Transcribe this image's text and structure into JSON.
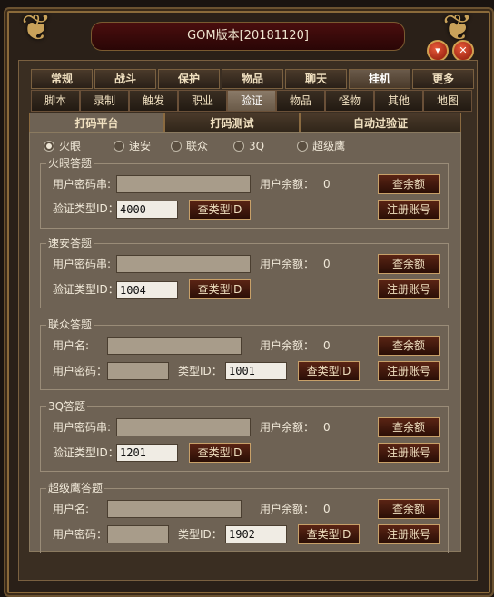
{
  "window": {
    "title": "GOM版本[20181120]"
  },
  "icons": {
    "minimize": "chevron-down-icon",
    "close": "close-icon",
    "corners": "dragon-ornament-icon"
  },
  "tabs_main": [
    {
      "label": "常规"
    },
    {
      "label": "战斗"
    },
    {
      "label": "保护"
    },
    {
      "label": "物品"
    },
    {
      "label": "聊天"
    },
    {
      "label": "挂机"
    },
    {
      "label": "更多"
    }
  ],
  "tabs_sub": [
    {
      "label": "脚本"
    },
    {
      "label": "录制"
    },
    {
      "label": "触发"
    },
    {
      "label": "职业"
    },
    {
      "label": "验证"
    },
    {
      "label": "物品"
    },
    {
      "label": "怪物"
    },
    {
      "label": "其他"
    },
    {
      "label": "地图"
    }
  ],
  "tabs_verify": [
    {
      "label": "打码平台"
    },
    {
      "label": "打码测试"
    },
    {
      "label": "自动过验证"
    }
  ],
  "platforms": [
    {
      "label": "火眼",
      "selected": true
    },
    {
      "label": "速安",
      "selected": false
    },
    {
      "label": "联众",
      "selected": false
    },
    {
      "label": "3Q",
      "selected": false
    },
    {
      "label": "超级鹰",
      "selected": false
    }
  ],
  "groups": [
    {
      "title": "火眼答题",
      "field1_label": "用户密码串:",
      "balance_label": "用户余额：",
      "balance_value": "0",
      "type_label": "验证类型ID：",
      "type_value": "4000",
      "btn_type": "查类型ID",
      "btn_balance": "查余额",
      "btn_register": "注册账号"
    },
    {
      "title": "速安答题",
      "field1_label": "用户密码串:",
      "balance_label": "用户余额：",
      "balance_value": "0",
      "type_label": "验证类型ID：",
      "type_value": "1004",
      "btn_type": "查类型ID",
      "btn_balance": "查余额",
      "btn_register": "注册账号"
    },
    {
      "title": "联众答题",
      "field1_label": "用户名:",
      "balance_label": "用户余额：",
      "balance_value": "0",
      "pwd_label": "用户密码：",
      "type_label": "类型ID：",
      "type_value": "1001",
      "btn_type": "查类型ID",
      "btn_balance": "查余额",
      "btn_register": "注册账号"
    },
    {
      "title": "3Q答题",
      "field1_label": "用户密码串:",
      "balance_label": "用户余额：",
      "balance_value": "0",
      "type_label": "验证类型ID：",
      "type_value": "1201",
      "btn_type": "查类型ID",
      "btn_balance": "查余额",
      "btn_register": "注册账号"
    },
    {
      "title": "超级鹰答题",
      "field1_label": "用户名:",
      "balance_label": "用户余额：",
      "balance_value": "0",
      "pwd_label": "用户密码：",
      "type_label": "类型ID：",
      "type_value": "1902",
      "btn_type": "查类型ID",
      "btn_balance": "查余额",
      "btn_register": "注册账号"
    }
  ]
}
